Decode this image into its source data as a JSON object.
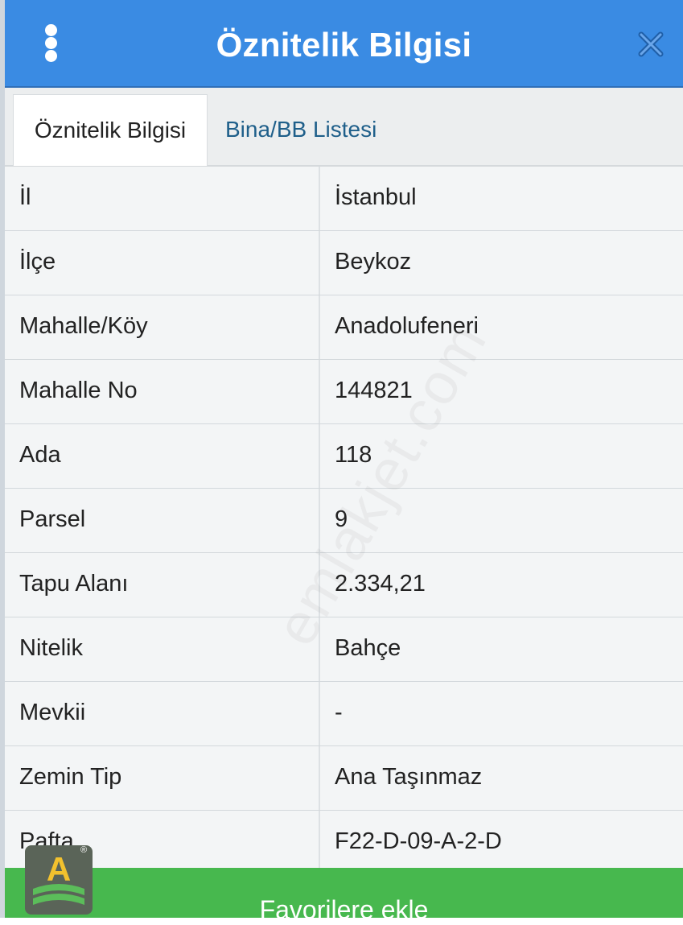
{
  "header": {
    "title": "Öznitelik Bilgisi",
    "menu_icon": "vertical-dots-icon",
    "close_icon": "close-icon"
  },
  "tabs": [
    {
      "label": "Öznitelik Bilgisi",
      "active": true
    },
    {
      "label": "Bina/BB Listesi",
      "active": false
    }
  ],
  "rows": [
    {
      "key": "İl",
      "value": "İstanbul"
    },
    {
      "key": "İlçe",
      "value": "Beykoz"
    },
    {
      "key": "Mahalle/Köy",
      "value": "Anadolufeneri"
    },
    {
      "key": "Mahalle No",
      "value": "144821"
    },
    {
      "key": "Ada",
      "value": "118"
    },
    {
      "key": "Parsel",
      "value": "9"
    },
    {
      "key": "Tapu Alanı",
      "value": "2.334,21"
    },
    {
      "key": "Nitelik",
      "value": "Bahçe"
    },
    {
      "key": "Mevkii",
      "value": "-"
    },
    {
      "key": "Zemin Tip",
      "value": "Ana Taşınmaz"
    },
    {
      "key": "Pafta",
      "value": "F22-D-09-A-2-D"
    }
  ],
  "watermark": "emlakjet.com",
  "footer": {
    "button_label": "Favorilere ekle"
  },
  "logo": {
    "symbol": "A",
    "registered": "®"
  },
  "colors": {
    "header": "#3a8be3",
    "footer": "#47b84e",
    "tab_link": "#1f5f8a",
    "row_bg": "#f3f5f6"
  }
}
